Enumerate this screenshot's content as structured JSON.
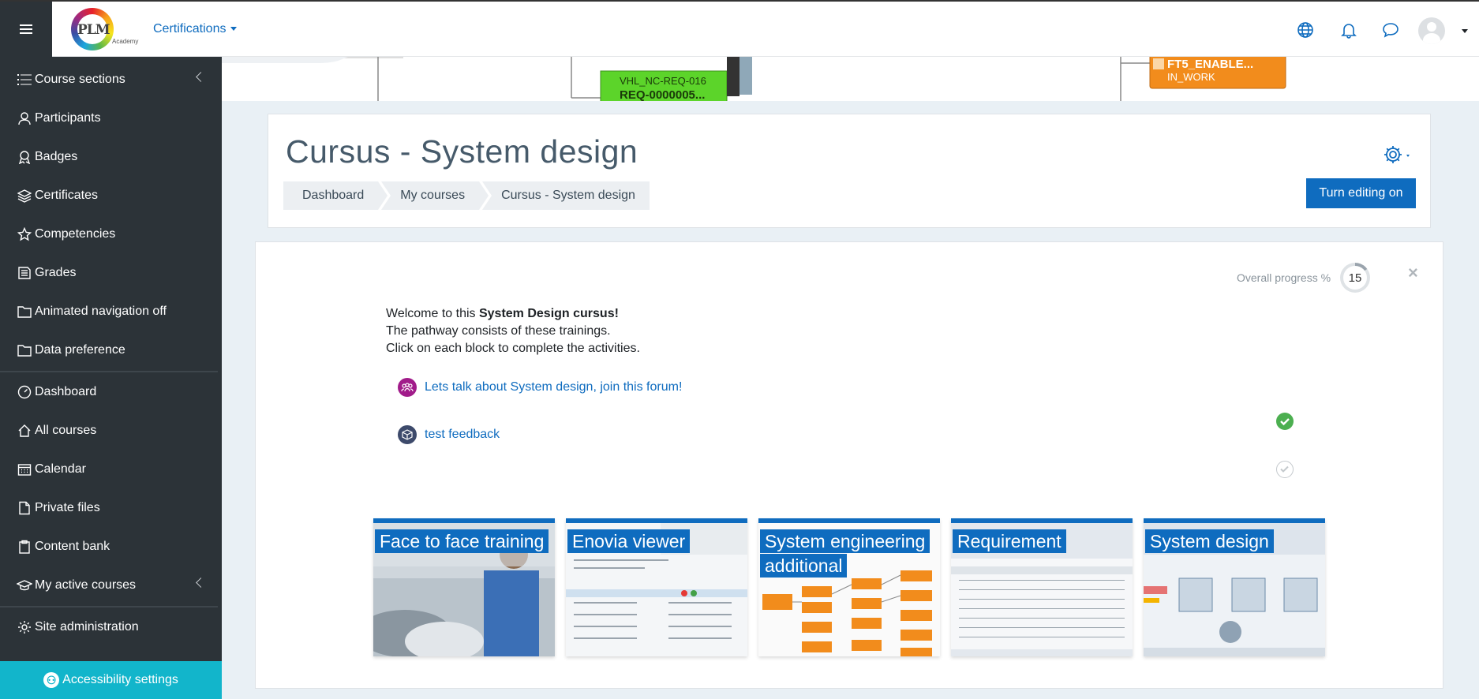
{
  "navbar": {
    "menu_label": "Certifications",
    "logo_text": "PLM",
    "logo_sub": "Academy",
    "icons": [
      "hamburger-icon",
      "globe-icon",
      "bell-icon",
      "chat-icon",
      "user-avatar"
    ]
  },
  "sidebar": {
    "items": [
      {
        "label": "Course sections",
        "icon": "list-icon"
      },
      {
        "label": "Participants",
        "icon": "user-icon"
      },
      {
        "label": "Badges",
        "icon": "badge-icon"
      },
      {
        "label": "Certificates",
        "icon": "layers-icon"
      },
      {
        "label": "Competencies",
        "icon": "star-icon"
      },
      {
        "label": "Grades",
        "icon": "table-icon"
      },
      {
        "label": "Animated navigation off",
        "icon": "folder-icon"
      },
      {
        "label": "Data preference",
        "icon": "folder-icon"
      },
      {
        "label": "Dashboard",
        "icon": "dashboard-icon"
      },
      {
        "label": "All courses",
        "icon": "home-icon"
      },
      {
        "label": "Calendar",
        "icon": "calendar-icon"
      },
      {
        "label": "Private files",
        "icon": "file-icon"
      },
      {
        "label": "Content bank",
        "icon": "clipboard-icon"
      },
      {
        "label": "My active courses",
        "icon": "graduation-icon"
      },
      {
        "label": "Site administration",
        "icon": "gear-icon"
      }
    ],
    "accessibility_label": "Accessibility settings"
  },
  "banner": {
    "node1_title": "VHL_NC-REQ-016",
    "node1_id": "REQ-0000005...",
    "node2_title": "FT5_ENABLE...",
    "node2_status": "IN_WORK"
  },
  "header": {
    "title": "Cursus - System design",
    "breadcrumbs": [
      "Dashboard",
      "My courses",
      "Cursus - System design"
    ],
    "edit_button": "Turn editing on"
  },
  "main": {
    "progress_label": "Overall progress %",
    "progress_value": "15",
    "progress_fraction": 0.15,
    "close_label": "×",
    "welcome_prefix": "Welcome to this ",
    "welcome_bold": "System Design cursus!",
    "welcome_line2": "The pathway consists of these trainings.",
    "welcome_line3": "Click on each block to complete the activities.",
    "activities": [
      {
        "label": "Lets talk about System design, join this forum!",
        "icon": "forum-icon",
        "completed": true
      },
      {
        "label": "test feedback",
        "icon": "feedback-icon",
        "completed": false
      }
    ],
    "tiles": [
      {
        "label": "Face to face training"
      },
      {
        "label": "Enovia viewer"
      },
      {
        "label": "System engineering additional"
      },
      {
        "label": "Requirement"
      },
      {
        "label": "System design"
      }
    ]
  },
  "colors": {
    "primary": "#0f6cbf",
    "sidebar_bg": "#2c3338",
    "accessibility_bg": "#12b5cb",
    "title_color": "#465a6a",
    "check_green": "#4caf50",
    "banner_green": "#5cd42a",
    "banner_orange": "#f28c1c"
  }
}
